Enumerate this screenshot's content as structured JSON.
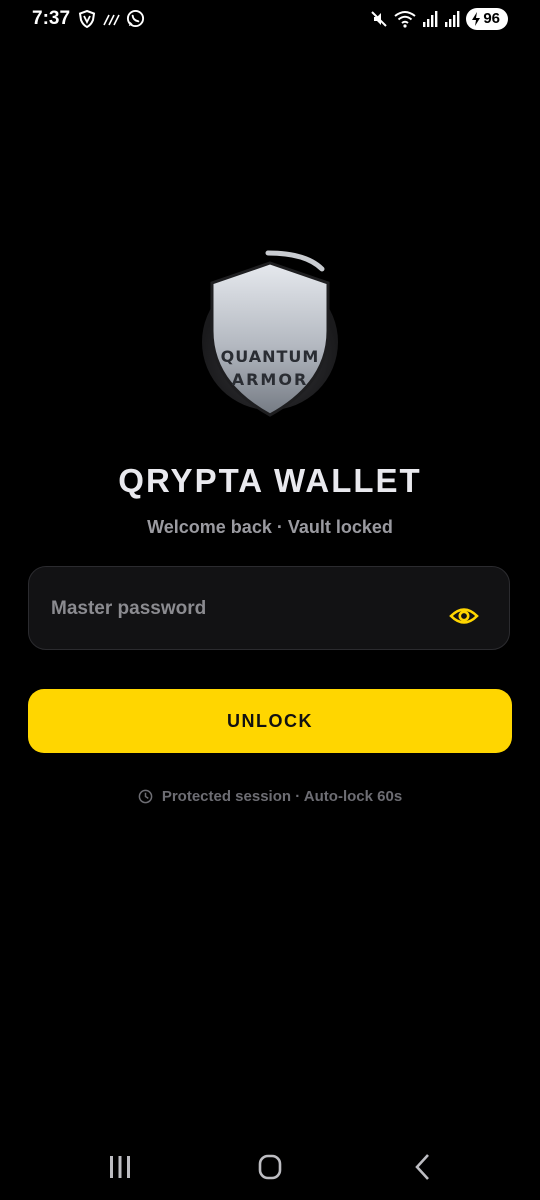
{
  "status_bar": {
    "time": "7:37",
    "battery_level": "96",
    "icons_left": [
      "vpn-shield-icon",
      "signal-hash-icon",
      "whatsapp-icon"
    ],
    "icons_right": [
      "mute-icon",
      "wifi-icon",
      "signal-bars-icon",
      "signal-bars-icon",
      "battery-charging-icon"
    ]
  },
  "logo": {
    "line1": "QUANTUM",
    "line2": "ARMOR"
  },
  "app": {
    "title": "QRYPTA WALLET",
    "subtitle": "Welcome back · Vault locked"
  },
  "form": {
    "password_placeholder": "Master password",
    "password_value": "",
    "unlock_label": "UNLOCK"
  },
  "session": {
    "note": "Protected session · Auto-lock 60s"
  },
  "colors": {
    "background": "#000000",
    "accent": "#ffd600",
    "field_bg": "#121214",
    "muted_text": "#6d6d73"
  },
  "nav": {
    "buttons": [
      "recents-icon",
      "home-icon",
      "back-icon"
    ]
  }
}
